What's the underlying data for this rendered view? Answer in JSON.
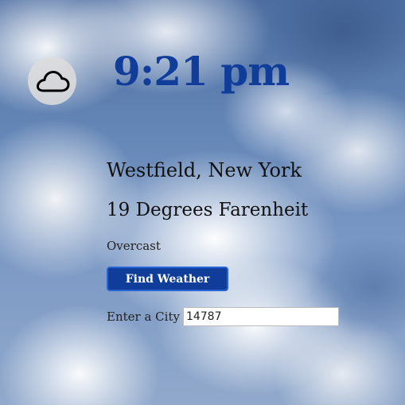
{
  "weather": {
    "time": "9:21 pm",
    "location": "Westfield, New York",
    "temperature": "19 Degrees Farenheit",
    "condition": "Overcast",
    "icon": "cloud-icon"
  },
  "search": {
    "button_label": "Find Weather",
    "city_label": "Enter a City",
    "city_value": "14787"
  },
  "colors": {
    "accent": "#103d9a",
    "button_border": "#2a65d8",
    "text_dark": "#111111"
  }
}
